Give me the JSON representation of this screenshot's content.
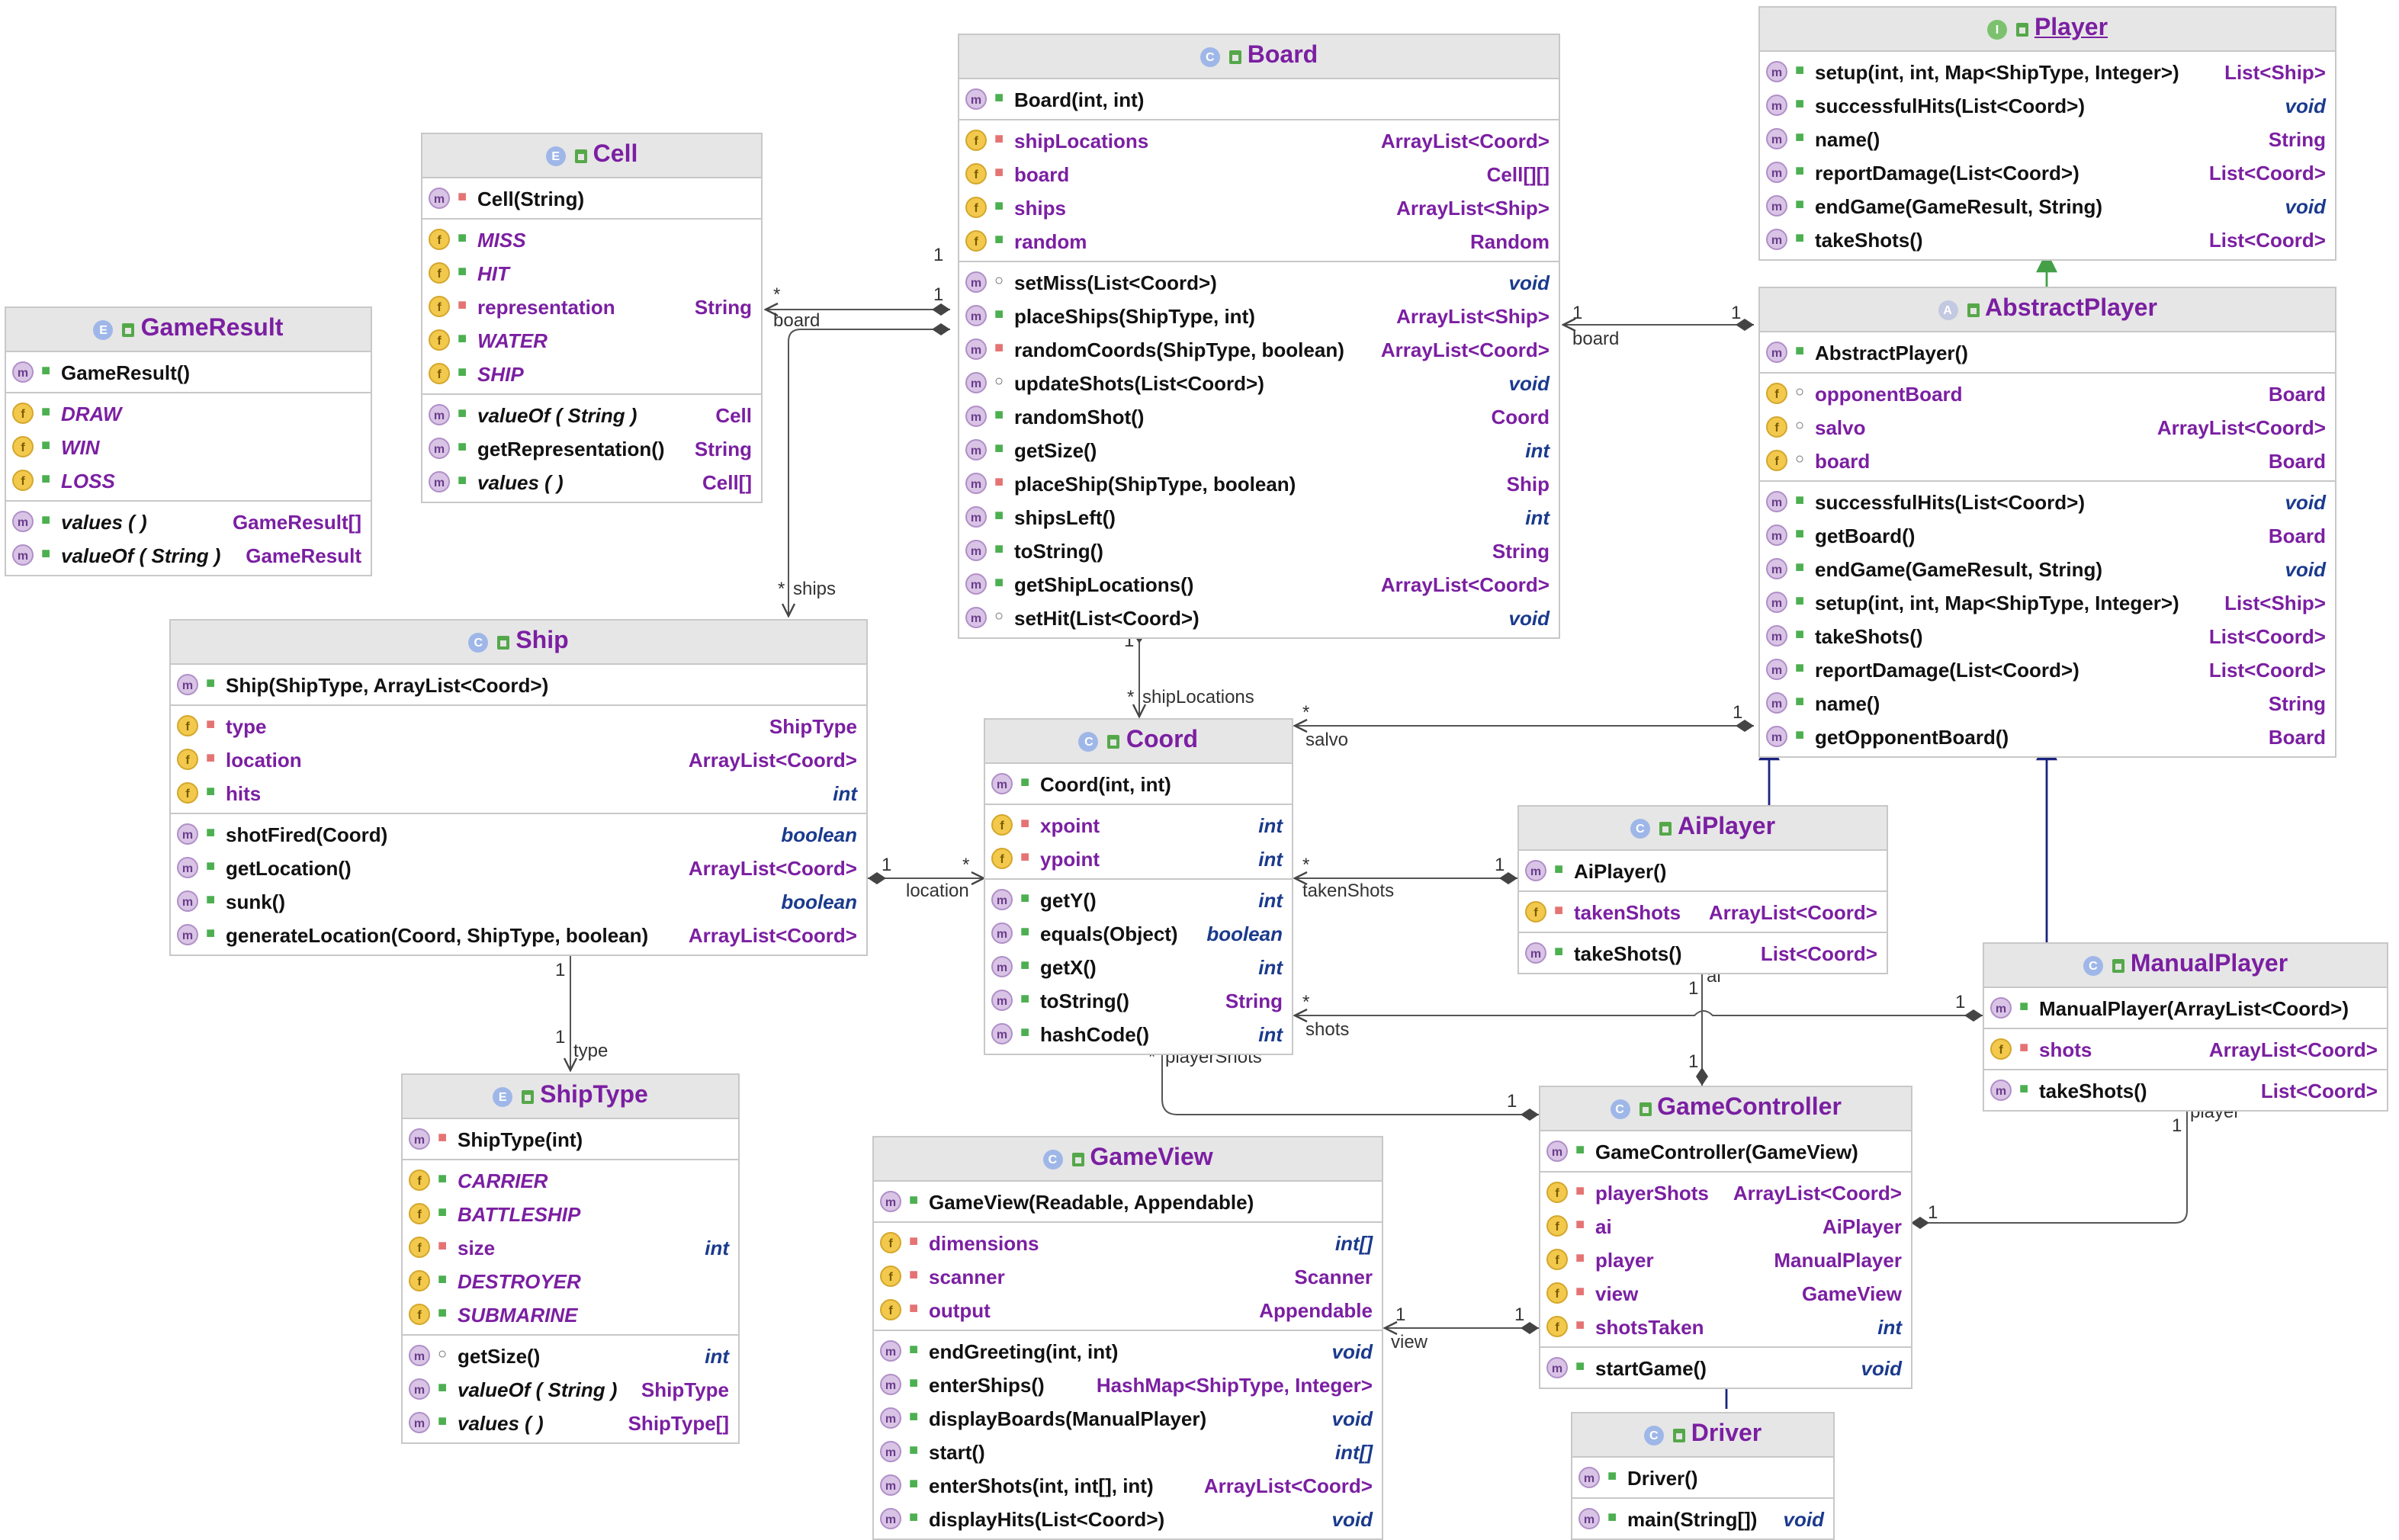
{
  "classes": [
    {
      "id": "gameresult",
      "name": "GameResult",
      "kind": "E",
      "rows": [
        [
          {
            "i": "m",
            "v": "pub",
            "n": "GameResult()"
          }
        ],
        [
          {
            "i": "f",
            "v": "pub",
            "n": "DRAW",
            "it": true,
            "fld": true
          },
          {
            "i": "f",
            "v": "pub",
            "n": "WIN",
            "it": true,
            "fld": true
          },
          {
            "i": "f",
            "v": "pub",
            "n": "LOSS",
            "it": true,
            "fld": true
          }
        ],
        [
          {
            "i": "m",
            "v": "pub",
            "n": "values ( )",
            "it": true,
            "t": "GameResult[]"
          },
          {
            "i": "m",
            "v": "pub",
            "n": "valueOf ( String )",
            "it": true,
            "t": "GameResult"
          }
        ]
      ]
    },
    {
      "id": "cell",
      "name": "Cell",
      "kind": "E",
      "rows": [
        [
          {
            "i": "m",
            "v": "priv",
            "n": "Cell(String)"
          }
        ],
        [
          {
            "i": "f",
            "v": "pub",
            "n": "MISS",
            "it": true,
            "fld": true
          },
          {
            "i": "f",
            "v": "pub",
            "n": "HIT",
            "it": true,
            "fld": true
          },
          {
            "i": "f",
            "v": "priv",
            "n": "representation",
            "fld": true,
            "t": "String"
          },
          {
            "i": "f",
            "v": "pub",
            "n": "WATER",
            "it": true,
            "fld": true
          },
          {
            "i": "f",
            "v": "pub",
            "n": "SHIP",
            "it": true,
            "fld": true
          }
        ],
        [
          {
            "i": "m",
            "v": "pub",
            "n": "valueOf ( String )",
            "it": true,
            "t": "Cell"
          },
          {
            "i": "m",
            "v": "pub",
            "n": "getRepresentation()",
            "t": "String"
          },
          {
            "i": "m",
            "v": "pub",
            "n": "values ( )",
            "it": true,
            "t": "Cell[]"
          }
        ]
      ]
    },
    {
      "id": "board",
      "name": "Board",
      "kind": "C",
      "rows": [
        [
          {
            "i": "m",
            "v": "pub",
            "n": "Board(int, int)"
          }
        ],
        [
          {
            "i": "f",
            "v": "priv",
            "n": "shipLocations",
            "fld": true,
            "t": "ArrayList<Coord>"
          },
          {
            "i": "f",
            "v": "priv",
            "n": "board",
            "fld": true,
            "t": "Cell[][]"
          },
          {
            "i": "f",
            "v": "pub",
            "n": "ships",
            "fld": true,
            "t": "ArrayList<Ship>"
          },
          {
            "i": "f",
            "v": "pub",
            "n": "random",
            "fld": true,
            "t": "Random"
          }
        ],
        [
          {
            "i": "m",
            "v": "pkg",
            "n": "setMiss(List<Coord>)",
            "t": "void",
            "p": 1
          },
          {
            "i": "m",
            "v": "pub",
            "n": "placeShips(ShipType, int)",
            "t": "ArrayList<Ship>"
          },
          {
            "i": "m",
            "v": "priv",
            "n": "randomCoords(ShipType, boolean)",
            "t": "ArrayList<Coord>"
          },
          {
            "i": "m",
            "v": "pkg",
            "n": "updateShots(List<Coord>)",
            "t": "void",
            "p": 1
          },
          {
            "i": "m",
            "v": "pub",
            "n": "randomShot()",
            "t": "Coord"
          },
          {
            "i": "m",
            "v": "pub",
            "n": "getSize()",
            "t": "int",
            "p": 1
          },
          {
            "i": "m",
            "v": "priv",
            "n": "placeShip(ShipType, boolean)",
            "t": "Ship"
          },
          {
            "i": "m",
            "v": "pub",
            "n": "shipsLeft()",
            "t": "int",
            "p": 1
          },
          {
            "i": "m",
            "v": "pub",
            "n": "toString()",
            "t": "String"
          },
          {
            "i": "m",
            "v": "pub",
            "n": "getShipLocations()",
            "t": "ArrayList<Coord>"
          },
          {
            "i": "m",
            "v": "pkg",
            "n": "setHit(List<Coord>)",
            "t": "void",
            "p": 1
          }
        ]
      ]
    },
    {
      "id": "player",
      "name": "Player",
      "kind": "I",
      "iface": true,
      "rows": [
        [
          {
            "i": "m",
            "v": "pub",
            "n": "setup(int, int, Map<ShipType, Integer>)",
            "t": "List<Ship>"
          },
          {
            "i": "m",
            "v": "pub",
            "n": "successfulHits(List<Coord>)",
            "t": "void",
            "p": 1
          },
          {
            "i": "m",
            "v": "pub",
            "n": "name()",
            "t": "String"
          },
          {
            "i": "m",
            "v": "pub",
            "n": "reportDamage(List<Coord>)",
            "t": "List<Coord>"
          },
          {
            "i": "m",
            "v": "pub",
            "n": "endGame(GameResult, String)",
            "t": "void",
            "p": 1
          },
          {
            "i": "m",
            "v": "pub",
            "n": "takeShots()",
            "t": "List<Coord>"
          }
        ]
      ]
    },
    {
      "id": "abstractplayer",
      "name": "AbstractPlayer",
      "kind": "A",
      "rows": [
        [
          {
            "i": "m",
            "v": "pub",
            "n": "AbstractPlayer()"
          }
        ],
        [
          {
            "i": "f",
            "v": "pkg",
            "n": "opponentBoard",
            "fld": true,
            "t": "Board"
          },
          {
            "i": "f",
            "v": "pkg",
            "n": "salvo",
            "fld": true,
            "t": "ArrayList<Coord>"
          },
          {
            "i": "f",
            "v": "pkg",
            "n": "board",
            "fld": true,
            "t": "Board"
          }
        ],
        [
          {
            "i": "m",
            "v": "pub",
            "n": "successfulHits(List<Coord>)",
            "t": "void",
            "p": 1
          },
          {
            "i": "m",
            "v": "pub",
            "n": "getBoard()",
            "t": "Board"
          },
          {
            "i": "m",
            "v": "pub",
            "n": "endGame(GameResult, String)",
            "t": "void",
            "p": 1
          },
          {
            "i": "m",
            "v": "pub",
            "n": "setup(int, int, Map<ShipType, Integer>)",
            "t": "List<Ship>"
          },
          {
            "i": "m",
            "v": "pub",
            "n": "takeShots()",
            "t": "List<Coord>"
          },
          {
            "i": "m",
            "v": "pub",
            "n": "reportDamage(List<Coord>)",
            "t": "List<Coord>"
          },
          {
            "i": "m",
            "v": "pub",
            "n": "name()",
            "t": "String"
          },
          {
            "i": "m",
            "v": "pub",
            "n": "getOpponentBoard()",
            "t": "Board"
          }
        ]
      ]
    },
    {
      "id": "ship",
      "name": "Ship",
      "kind": "C",
      "rows": [
        [
          {
            "i": "m",
            "v": "pub",
            "n": "Ship(ShipType, ArrayList<Coord>)"
          }
        ],
        [
          {
            "i": "f",
            "v": "priv",
            "n": "type",
            "fld": true,
            "t": "ShipType"
          },
          {
            "i": "f",
            "v": "priv",
            "n": "location",
            "fld": true,
            "t": "ArrayList<Coord>"
          },
          {
            "i": "f",
            "v": "pub",
            "n": "hits",
            "fld": true,
            "t": "int",
            "p": 1
          }
        ],
        [
          {
            "i": "m",
            "v": "pub",
            "n": "shotFired(Coord)",
            "t": "boolean",
            "p": 1
          },
          {
            "i": "m",
            "v": "pub",
            "n": "getLocation()",
            "t": "ArrayList<Coord>"
          },
          {
            "i": "m",
            "v": "pub",
            "n": "sunk()",
            "t": "boolean",
            "p": 1
          },
          {
            "i": "m",
            "v": "pub",
            "n": "generateLocation(Coord, ShipType, boolean)",
            "t": "ArrayList<Coord>"
          }
        ]
      ]
    },
    {
      "id": "coord",
      "name": "Coord",
      "kind": "C",
      "rows": [
        [
          {
            "i": "m",
            "v": "pub",
            "n": "Coord(int, int)"
          }
        ],
        [
          {
            "i": "f",
            "v": "priv",
            "n": "xpoint",
            "fld": true,
            "t": "int",
            "p": 1
          },
          {
            "i": "f",
            "v": "priv",
            "n": "ypoint",
            "fld": true,
            "t": "int",
            "p": 1
          }
        ],
        [
          {
            "i": "m",
            "v": "pub",
            "n": "getY()",
            "t": "int",
            "p": 1
          },
          {
            "i": "m",
            "v": "pub",
            "n": "equals(Object)",
            "t": "boolean",
            "p": 1
          },
          {
            "i": "m",
            "v": "pub",
            "n": "getX()",
            "t": "int",
            "p": 1
          },
          {
            "i": "m",
            "v": "pub",
            "n": "toString()",
            "t": "String"
          },
          {
            "i": "m",
            "v": "pub",
            "n": "hashCode()",
            "t": "int",
            "p": 1
          }
        ]
      ]
    },
    {
      "id": "aiplayer",
      "name": "AiPlayer",
      "kind": "C",
      "rows": [
        [
          {
            "i": "m",
            "v": "pub",
            "n": "AiPlayer()"
          }
        ],
        [
          {
            "i": "f",
            "v": "priv",
            "n": "takenShots",
            "fld": true,
            "t": "ArrayList<Coord>"
          }
        ],
        [
          {
            "i": "m",
            "v": "pub",
            "n": "takeShots()",
            "t": "List<Coord>"
          }
        ]
      ]
    },
    {
      "id": "manualplayer",
      "name": "ManualPlayer",
      "kind": "C",
      "rows": [
        [
          {
            "i": "m",
            "v": "pub",
            "n": "ManualPlayer(ArrayList<Coord>)"
          }
        ],
        [
          {
            "i": "f",
            "v": "priv",
            "n": "shots",
            "fld": true,
            "t": "ArrayList<Coord>"
          }
        ],
        [
          {
            "i": "m",
            "v": "pub",
            "n": "takeShots()",
            "t": "List<Coord>"
          }
        ]
      ]
    },
    {
      "id": "shiptype",
      "name": "ShipType",
      "kind": "E",
      "rows": [
        [
          {
            "i": "m",
            "v": "priv",
            "n": "ShipType(int)"
          }
        ],
        [
          {
            "i": "f",
            "v": "pub",
            "n": "CARRIER",
            "it": true,
            "fld": true
          },
          {
            "i": "f",
            "v": "pub",
            "n": "BATTLESHIP",
            "it": true,
            "fld": true
          },
          {
            "i": "f",
            "v": "priv",
            "n": "size",
            "fld": true,
            "t": "int",
            "p": 1
          },
          {
            "i": "f",
            "v": "pub",
            "n": "DESTROYER",
            "it": true,
            "fld": true
          },
          {
            "i": "f",
            "v": "pub",
            "n": "SUBMARINE",
            "it": true,
            "fld": true
          }
        ],
        [
          {
            "i": "m",
            "v": "pkg",
            "n": "getSize()",
            "t": "int",
            "p": 1
          },
          {
            "i": "m",
            "v": "pub",
            "n": "valueOf ( String )",
            "it": true,
            "t": "ShipType"
          },
          {
            "i": "m",
            "v": "pub",
            "n": "values ( )",
            "it": true,
            "t": "ShipType[]"
          }
        ]
      ]
    },
    {
      "id": "gameview",
      "name": "GameView",
      "kind": "C",
      "rows": [
        [
          {
            "i": "m",
            "v": "pub",
            "n": "GameView(Readable, Appendable)"
          }
        ],
        [
          {
            "i": "f",
            "v": "priv",
            "n": "dimensions",
            "fld": true,
            "t": "int[]",
            "p": 1
          },
          {
            "i": "f",
            "v": "priv",
            "n": "scanner",
            "fld": true,
            "t": "Scanner"
          },
          {
            "i": "f",
            "v": "priv",
            "n": "output",
            "fld": true,
            "t": "Appendable"
          }
        ],
        [
          {
            "i": "m",
            "v": "pub",
            "n": "endGreeting(int, int)",
            "t": "void",
            "p": 1
          },
          {
            "i": "m",
            "v": "pub",
            "n": "enterShips()",
            "t": "HashMap<ShipType, Integer>"
          },
          {
            "i": "m",
            "v": "pub",
            "n": "displayBoards(ManualPlayer)",
            "t": "void",
            "p": 1
          },
          {
            "i": "m",
            "v": "pub",
            "n": "start()",
            "t": "int[]",
            "p": 1
          },
          {
            "i": "m",
            "v": "pub",
            "n": "enterShots(int, int[], int)",
            "t": "ArrayList<Coord>"
          },
          {
            "i": "m",
            "v": "pub",
            "n": "displayHits(List<Coord>)",
            "t": "void",
            "p": 1
          }
        ]
      ]
    },
    {
      "id": "gamecontroller",
      "name": "GameController",
      "kind": "C",
      "rows": [
        [
          {
            "i": "m",
            "v": "pub",
            "n": "GameController(GameView)"
          }
        ],
        [
          {
            "i": "f",
            "v": "priv",
            "n": "playerShots",
            "fld": true,
            "t": "ArrayList<Coord>"
          },
          {
            "i": "f",
            "v": "priv",
            "n": "ai",
            "fld": true,
            "t": "AiPlayer"
          },
          {
            "i": "f",
            "v": "priv",
            "n": "player",
            "fld": true,
            "t": "ManualPlayer"
          },
          {
            "i": "f",
            "v": "priv",
            "n": "view",
            "fld": true,
            "t": "GameView"
          },
          {
            "i": "f",
            "v": "priv",
            "n": "shotsTaken",
            "fld": true,
            "t": "int",
            "p": 1
          }
        ],
        [
          {
            "i": "m",
            "v": "pub",
            "n": "startGame()",
            "t": "void",
            "p": 1
          }
        ]
      ]
    },
    {
      "id": "driver",
      "name": "Driver",
      "kind": "C",
      "rows": [
        [
          {
            "i": "m",
            "v": "pub",
            "n": "Driver()"
          }
        ],
        [
          {
            "i": "m",
            "v": "pub",
            "n": "main(String[])",
            "t": "void",
            "p": 1
          }
        ]
      ]
    }
  ],
  "labels": {
    "board_ship_board": "board",
    "board_ship_ships": "ships",
    "board_coord_shiplocations": "shipLocations",
    "board_player_board": "board",
    "coord_salvo": "salvo",
    "coord_takenshots": "takenShots",
    "ship_coord_location": "location",
    "ship_shiptype_type": "type",
    "coord_shots": "shots",
    "coord_playershots": "playerShots",
    "gc_ai": "ai",
    "gc_player": "player",
    "gv_view": "view",
    "one": "1",
    "many": "*"
  }
}
